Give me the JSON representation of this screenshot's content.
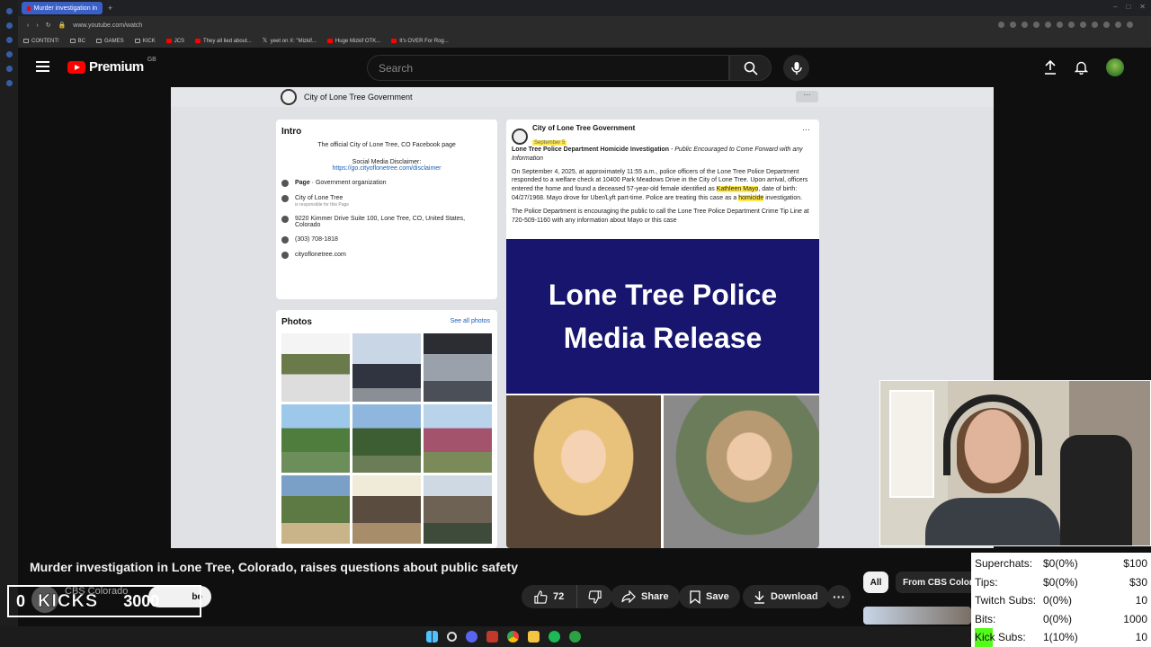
{
  "browser": {
    "tab_title": "Murder investigation in",
    "url": "www.youtube.com/watch",
    "bookmarks": [
      "CONTENT!",
      "BC",
      "GAMES",
      "KICK",
      "JCS",
      "They all lied about...",
      "yeet on X: \"Mizkif...",
      "Huge Mizkif OTK...",
      "It's OVER For Rog..."
    ]
  },
  "youtube": {
    "logo_text": "Premium",
    "region": "GB",
    "search_placeholder": "Search"
  },
  "video_frame": {
    "fb_page_name": "City of Lone Tree Government",
    "intro": {
      "heading": "Intro",
      "description": "The official City of Lone Tree, CO Facebook page",
      "disclaimer_label": "Social Media Disclaimer:",
      "disclaimer_link": "https://go.cityoflonetree.com/disclaimer",
      "page_type_label": "Page",
      "page_type": " · Government organization",
      "responsible_name": "City of Lone Tree",
      "responsible_sub": "is responsible for this Page",
      "address": "9220 Kimmer Drive Suite 100, Lone Tree, CO, United States, Colorado",
      "phone": "(303) 708-1818",
      "website": "cityoflonetree.com"
    },
    "photos": {
      "heading": "Photos",
      "see_all": "See all photos"
    },
    "post": {
      "author": "City of Lone Tree Government",
      "date": "September 5",
      "headline": "Lone Tree Police Department Homicide Investigation",
      "headline_sub": " - Public Encouraged to Come Forward with any Information",
      "p1_a": "On September 4, 2025, at approximately 11:55 a.m., police officers of the Lone Tree Police Department responded to a welfare check at 10400 Park Meadows Drive in the City of Lone Tree. Upon arrival, officers entered the home and found a deceased 57-year-old female identified as ",
      "p1_name": "Kathleen Mayo",
      "p1_b": ", date of birth: 04/27/1968. Mayo drove for Uber/Lyft part-time. Police are treating this case as a ",
      "p1_hl": "homicide",
      "p1_c": " investigation.",
      "p2": "The Police Department is encouraging the public to call the Lone Tree Police Department Crime Tip Line at 720-509-1160 with any information about Mayo or this case",
      "release_line1": "Lone Tree Police",
      "release_line2": "Media Release"
    }
  },
  "video_info": {
    "title": "Murder investigation in Lone Tree, Colorado, raises questions about public safety",
    "channel": "CBS Colorado",
    "subscribe": "be",
    "likes": "72",
    "share": "Share",
    "save": "Save",
    "download": "Download",
    "chip_all": "All",
    "chip_channel": "From CBS Colorado"
  },
  "kicks_overlay": {
    "count": "0",
    "label": "KICKS",
    "goal": "3000"
  },
  "stats_overlay": {
    "rows": [
      {
        "label": "Superchats:",
        "value": "$0(0%)",
        "goal": "$100"
      },
      {
        "label": "Tips:",
        "value": "$0(0%)",
        "goal": "$30"
      },
      {
        "label": "Twitch Subs:",
        "value": "0(0%)",
        "goal": "10"
      },
      {
        "label": "Bits:",
        "value": "0(0%)",
        "goal": "1000"
      },
      {
        "label": "Kick Subs:",
        "value": "1(10%)",
        "goal": "10"
      }
    ]
  }
}
